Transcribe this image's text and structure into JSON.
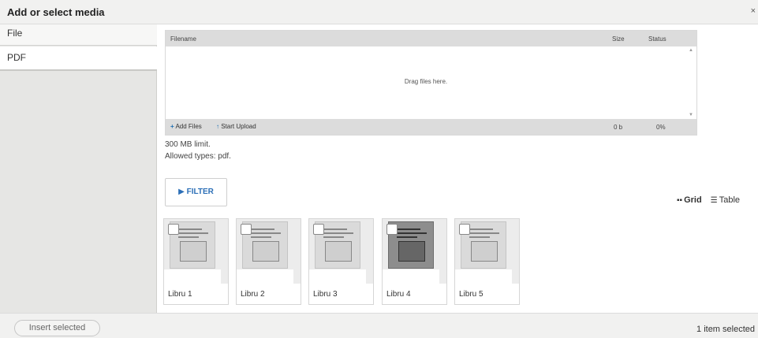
{
  "dialog": {
    "title": "Add or select media",
    "close_glyph": "×"
  },
  "sidebar": {
    "tabs": [
      {
        "label": "File"
      },
      {
        "label": "PDF"
      }
    ]
  },
  "uploader": {
    "columns": {
      "filename": "Filename",
      "size": "Size",
      "status": "Status"
    },
    "drop_text": "Drag files here.",
    "add_files_label": "Add Files",
    "start_upload_label": "Start Upload",
    "total_size": "0 b",
    "total_percent": "0%",
    "icons": {
      "add": "plus-icon",
      "upload": "arrow-up-icon"
    }
  },
  "info": {
    "limit_text": "300 MB limit.",
    "types_text": "Allowed types: pdf."
  },
  "filter": {
    "label": "FILTER",
    "icon": "triangle-right-icon"
  },
  "views": {
    "grid_label": "Grid",
    "table_label": "Table",
    "active": "Grid"
  },
  "media_items": [
    {
      "name": "Libru 1",
      "checked": false,
      "tone": "light"
    },
    {
      "name": "Libru 2",
      "checked": false,
      "tone": "light"
    },
    {
      "name": "Libru 3",
      "checked": false,
      "tone": "light"
    },
    {
      "name": "Libru 4",
      "checked": false,
      "tone": "dark"
    },
    {
      "name": "Libru 5",
      "checked": false,
      "tone": "light"
    }
  ],
  "footer": {
    "insert_label": "Insert selected",
    "selection_status": "1 item selected"
  },
  "colors": {
    "accent": "#2c6fb7",
    "sidebar": "#e6e6e4",
    "header_bar": "#dcdcdc"
  }
}
